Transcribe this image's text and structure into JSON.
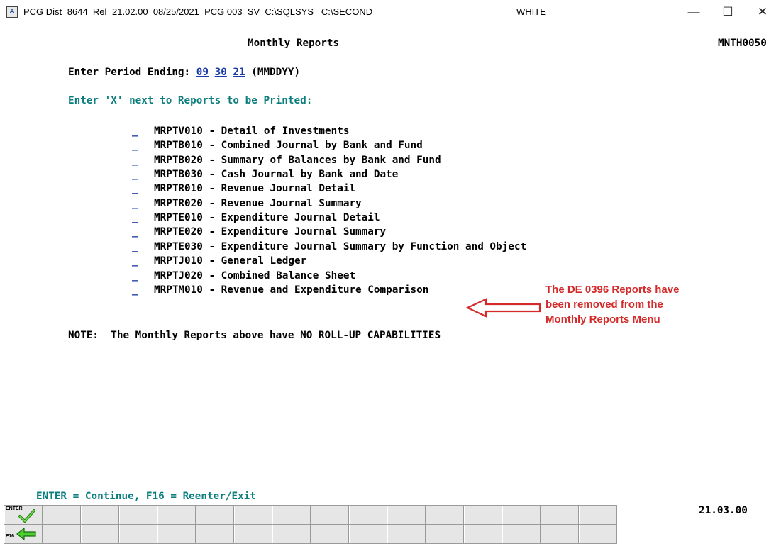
{
  "window": {
    "title": "PCG Dist=8644  Rel=21.02.00  08/25/2021  PCG 003  SV  C:\\SQLSYS   C:\\SECOND",
    "user": "WHITE",
    "minimize_glyph": "—",
    "maximize_glyph": "☐",
    "close_glyph": "✕"
  },
  "screen": {
    "title": "Monthly Reports",
    "screen_id": "MNTH0050",
    "period_label": "Enter Period Ending:",
    "period_mm": "09",
    "period_dd": "30",
    "period_yy": "21",
    "period_format": "(MMDDYY)",
    "instruction": "Enter 'X' next to Reports to be Printed:",
    "mark_placeholder": "_",
    "reports": [
      "MRPTV010 - Detail of Investments",
      "MRPTB010 - Combined Journal by Bank and Fund",
      "MRPTB020 - Summary of Balances by Bank and Fund",
      "MRPTB030 - Cash Journal by Bank and Date",
      "MRPTR010 - Revenue Journal Detail",
      "MRPTR020 - Revenue Journal Summary",
      "MRPTE010 - Expenditure Journal Detail",
      "MRPTE020 - Expenditure Journal Summary",
      "MRPTE030 - Expenditure Journal Summary by Function and Object",
      "MRPTJ010 - General Ledger",
      "MRPTJ020 - Combined Balance Sheet",
      "MRPTM010 - Revenue and Expenditure Comparison"
    ],
    "note": "NOTE:  The Monthly Reports above have NO ROLL-UP CAPABILITIES",
    "footer_hint": "ENTER = Continue, F16 = Reenter/Exit",
    "version": "21.03.00"
  },
  "annotation": {
    "lines": [
      "The DE 0396 Reports have",
      "been removed from the",
      "Monthly Reports Menu"
    ],
    "color": "#d42a2a"
  },
  "function_keys": {
    "enter_label": "ENTER",
    "f16_label": "F16",
    "enter_icon": "green-checkmark-icon",
    "f16_icon": "green-left-arrow-icon"
  },
  "colors": {
    "teal": "#0a7d7d",
    "link_blue": "#1a3aa8",
    "annotation_red": "#d42a2a"
  }
}
